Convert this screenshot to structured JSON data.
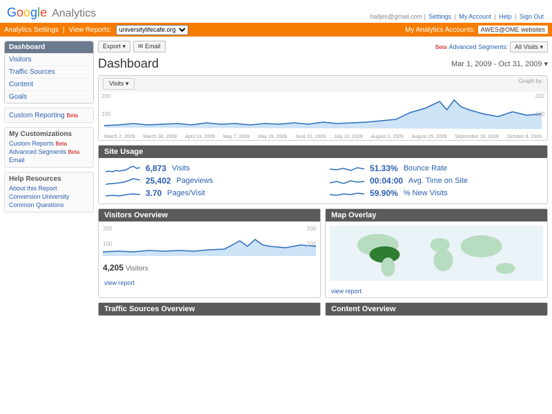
{
  "logo": {
    "brand": "Google",
    "product": "Analytics"
  },
  "toplinks": {
    "email": "halljes@gmail.com",
    "settings": "Settings",
    "account": "My Account",
    "help": "Help",
    "signout": "Sign Out"
  },
  "orangebar": {
    "settings": "Analytics Settings",
    "viewreports": "View Reports:",
    "site": "universitylifecafe.org",
    "myaccounts": "My Analytics Accounts:",
    "acct": "AWES@OME websites"
  },
  "sidebar": {
    "dashboard": "Dashboard",
    "items": [
      "Visitors",
      "Traffic Sources",
      "Content",
      "Goals"
    ],
    "custom": {
      "title": "Custom Reporting",
      "beta": "Beta"
    },
    "mycust": {
      "title": "My Customizations",
      "items": [
        "Custom Reports",
        "Advanced Segments",
        "Email"
      ],
      "beta": "Beta"
    },
    "help": {
      "title": "Help Resources",
      "items": [
        "About this Report",
        "Conversion University",
        "Common Questions"
      ]
    }
  },
  "toolbar": {
    "export": "Export ▾",
    "email": "✉ Email",
    "advseg": "Advanced Segments:",
    "allvisits": "All Visits ▾",
    "beta": "Beta"
  },
  "page_title": "Dashboard",
  "date_range": "Mar 1, 2009 - Oct 31, 2009 ▾",
  "visits_tab": "Visits ▾",
  "graph_label": "Graph by:",
  "main_chart_axis": {
    "ymax": "200",
    "ymid": "100"
  },
  "main_chart_xlabels": [
    "March 2, 2009",
    "March 30, 2009",
    "April 13, 2009",
    "May 7, 2009",
    "May 19, 2009",
    "June 22, 2009",
    "July 13, 2009",
    "August 3, 2009",
    "August 25, 2009",
    "September 18, 2009",
    "October 8, 2009"
  ],
  "site_usage": {
    "title": "Site Usage",
    "metrics": [
      {
        "value": "6,873",
        "label": "Visits"
      },
      {
        "value": "51.33%",
        "label": "Bounce Rate"
      },
      {
        "value": "25,402",
        "label": "Pageviews"
      },
      {
        "value": "00:04:00",
        "label": "Avg. Time on Site"
      },
      {
        "value": "3.70",
        "label": "Pages/Visit"
      },
      {
        "value": "59.90%",
        "label": "% New Visits"
      }
    ]
  },
  "visitors_overview": {
    "title": "Visitors Overview",
    "ymax": "200",
    "ymid": "100",
    "total_val": "4,205",
    "total_lbl": "Visitors",
    "view": "view report"
  },
  "map_overlay": {
    "title": "Map Overlay",
    "view": "view report"
  },
  "traffic_overview": {
    "title": "Traffic Sources Overview"
  },
  "content_overview": {
    "title": "Content Overview"
  },
  "chart_data": {
    "type": "line",
    "title": "Visits",
    "xlabel": "",
    "ylabel": "Visits",
    "ylim": [
      0,
      200
    ],
    "x": [
      "Mar 2",
      "Mar 30",
      "Apr 13",
      "May 7",
      "May 19",
      "Jun 22",
      "Jul 13",
      "Aug 3",
      "Aug 25",
      "Sep 18",
      "Oct 8"
    ],
    "values": [
      20,
      25,
      30,
      28,
      32,
      30,
      35,
      40,
      95,
      160,
      100
    ]
  }
}
